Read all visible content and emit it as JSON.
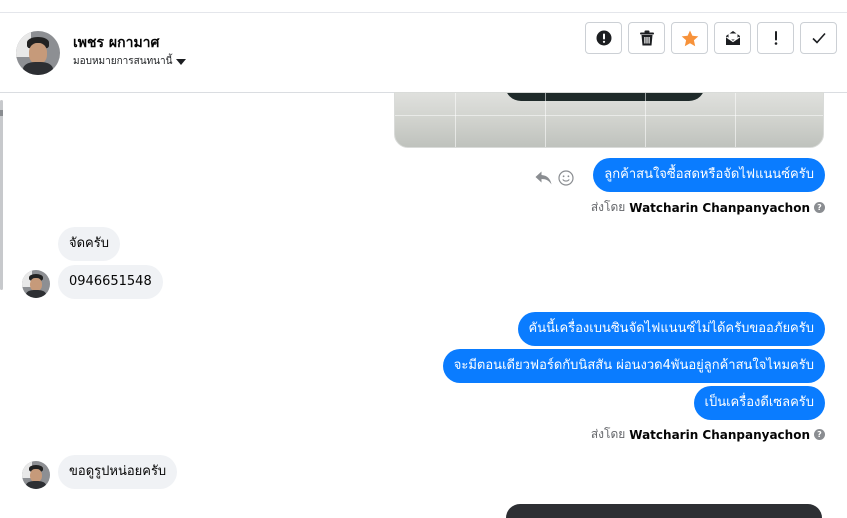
{
  "header": {
    "contact_name": "เพชร ผกามาศ",
    "assign_label": "มอบหมายการสนทนานี้"
  },
  "toolbar": {
    "buttons": [
      {
        "name": "spam",
        "icon": "alert-circle-icon"
      },
      {
        "name": "delete",
        "icon": "trash-icon"
      },
      {
        "name": "star",
        "icon": "star-icon",
        "color": "#f7923a"
      },
      {
        "name": "mark-unread",
        "icon": "envelope-icon"
      },
      {
        "name": "follow-up",
        "icon": "exclamation-icon"
      },
      {
        "name": "done",
        "icon": "check-icon"
      }
    ]
  },
  "conversation": {
    "messages": [
      {
        "direction": "out",
        "text": "ลูกค้าสนใจซื้อสดหรือจัดไฟแนนซ์ครับ"
      },
      {
        "direction": "in",
        "text": "จัดครับ"
      },
      {
        "direction": "in",
        "text": "0946651548"
      },
      {
        "direction": "out",
        "text": "คันนี้เครื่องเบนซินจัดไฟแนนซ์ไม่ได้ครับขออภัยครับ"
      },
      {
        "direction": "out",
        "text": "จะมีตอนเดียวฟอร์ดกับนิสสัน ผ่อนงวด4พันอยู่ลูกค้าสนใจไหมครับ"
      },
      {
        "direction": "out",
        "text": "เป็นเครื่องดีเซลครับ"
      },
      {
        "direction": "in",
        "text": "ขอดูรูปหน่อยครับ"
      }
    ],
    "sent_by_prefix": "ส่งโดย",
    "sent_by_name": "Watcharin Chanpanyachon"
  },
  "colors": {
    "outgoing_bubble": "#0a7cff",
    "incoming_bubble": "#f0f2f5",
    "star_accent": "#f7923a"
  }
}
